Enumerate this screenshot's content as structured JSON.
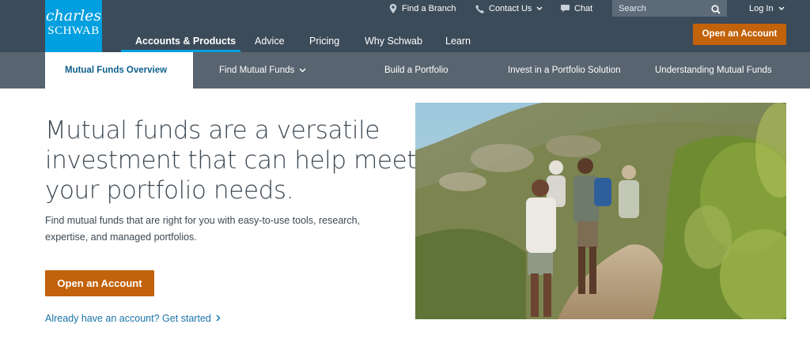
{
  "logo": {
    "line1": "charles",
    "line2": "SCHWAB"
  },
  "utility": {
    "find_branch": "Find a Branch",
    "contact": "Contact Us",
    "chat": "Chat",
    "search_placeholder": "Search",
    "login": "Log In"
  },
  "main_nav": {
    "items": [
      "Accounts & Products",
      "Advice",
      "Pricing",
      "Why Schwab",
      "Learn"
    ],
    "active": "Accounts & Products"
  },
  "header_cta": "Open an Account",
  "sub_nav": {
    "items": [
      "Mutual Funds Overview",
      "Find Mutual Funds",
      "Build a Portfolio",
      "Invest in a Portfolio Solution",
      "Understanding Mutual Funds"
    ],
    "active": "Mutual Funds Overview"
  },
  "hero": {
    "headline_lines": [
      "Mutual funds are a versatile",
      "investment that can help meet",
      "your portfolio needs."
    ],
    "description": "Find mutual funds that are right for you with easy-to-use tools, research, expertise, and managed portfolios.",
    "cta": "Open an Account",
    "login_link": "Already have an account? Get started"
  },
  "colors": {
    "header_bg": "#3c4b5a",
    "subnav_bg": "#58646f",
    "logo_bg": "#009fdf",
    "accent_orange": "#c2620a",
    "link_blue": "#1a73a8",
    "active_tab_text": "#0d5f8c"
  },
  "icons": [
    "location-pin-icon",
    "phone-icon",
    "chat-bubble-icon",
    "search-icon",
    "chevron-down-icon",
    "chevron-right-icon"
  ]
}
